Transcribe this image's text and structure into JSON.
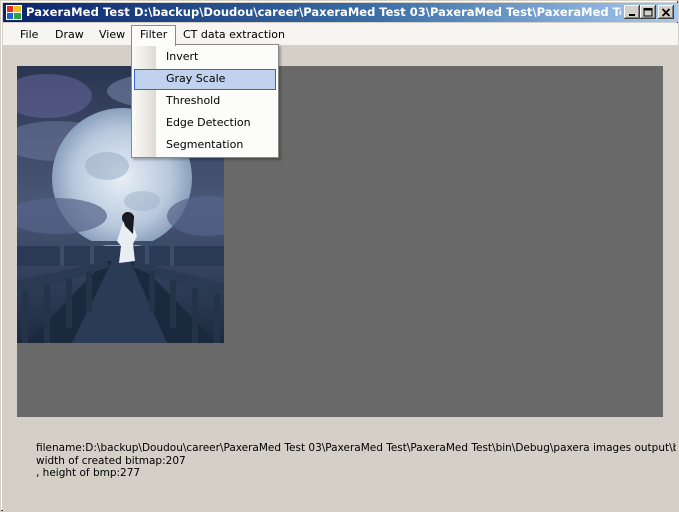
{
  "window": {
    "app_name": "PaxeraMed Test",
    "path": "D:\\backup\\Doudou\\career\\PaxeraMed Test 03\\PaxeraMed Test\\PaxeraMed Test\\bi..."
  },
  "menubar": {
    "items": [
      {
        "label": "File"
      },
      {
        "label": "Draw"
      },
      {
        "label": "View"
      },
      {
        "label": "Filter"
      },
      {
        "label": "CT data extraction"
      }
    ]
  },
  "filter_menu": {
    "items": [
      {
        "label": "Invert"
      },
      {
        "label": "Gray Scale"
      },
      {
        "label": "Threshold"
      },
      {
        "label": "Edge Detection"
      },
      {
        "label": "Segmentation"
      }
    ],
    "highlighted": "Gray Scale"
  },
  "info": {
    "filename": "filename:D:\\backup\\Doudou\\career\\PaxeraMed Test 03\\PaxeraMed Test\\PaxeraMed Test\\bin\\Debug\\paxera images output\\big_moon",
    "width_line": "width of created bitmap:207",
    "height_line": ", height of bmp:277"
  },
  "colors": {
    "title_start": "#0a246a",
    "title_end": "#a6caf0",
    "canvas_bg": "#696969",
    "menu_highlight": "#c1d2ee"
  },
  "icons": [
    "app-icon",
    "minimize-icon",
    "maximize-icon",
    "close-icon"
  ]
}
